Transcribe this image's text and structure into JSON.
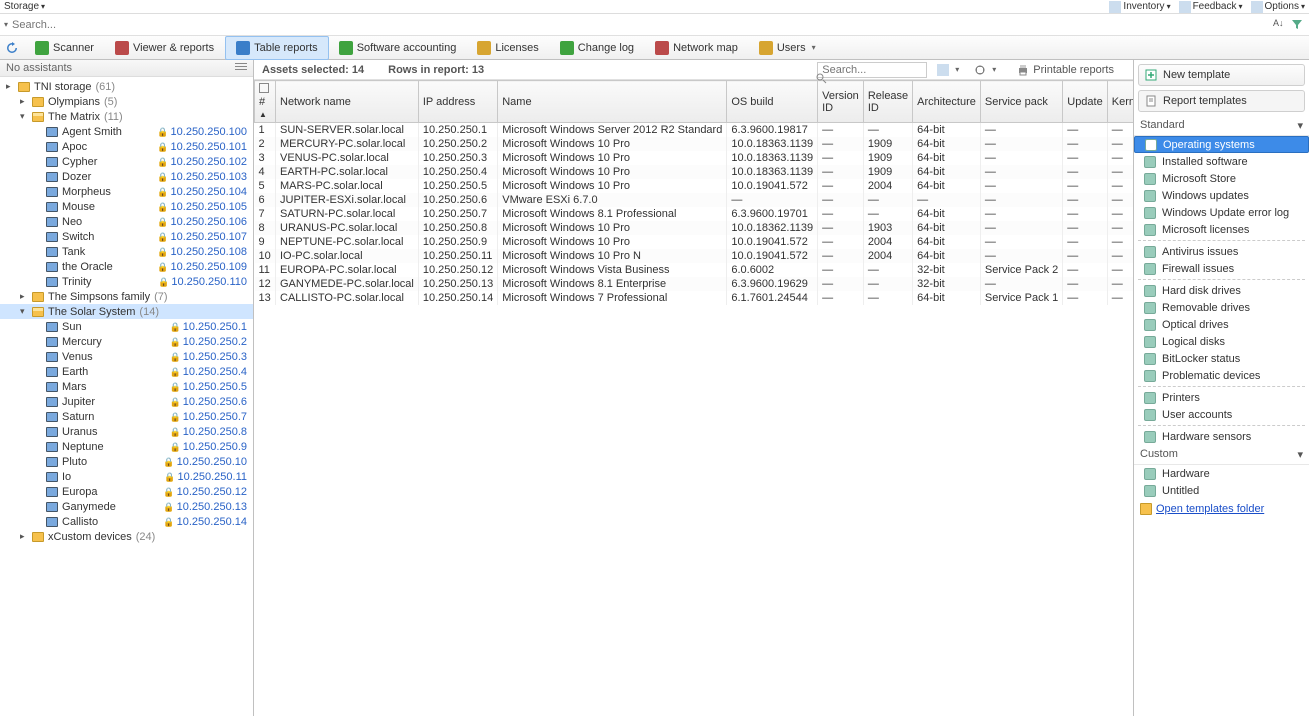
{
  "topbar": {
    "left": [
      {
        "label": "Storage",
        "dd": true
      }
    ],
    "right": [
      {
        "label": "Inventory",
        "dd": true
      },
      {
        "label": "Feedback",
        "dd": true
      },
      {
        "label": "Options",
        "dd": true
      }
    ]
  },
  "searchrow": {
    "placeholder": "Search..."
  },
  "toolbar": {
    "pre": {
      "name": "refresh"
    },
    "items": [
      {
        "name": "scanner",
        "label": "Scanner",
        "color": "#3fa33f"
      },
      {
        "name": "viewer",
        "label": "Viewer & reports",
        "color": "#bb4a4a"
      },
      {
        "name": "table",
        "label": "Table reports",
        "color": "#3a7ec9",
        "active": true
      },
      {
        "name": "software",
        "label": "Software accounting",
        "color": "#3fa33f"
      },
      {
        "name": "licenses",
        "label": "Licenses",
        "color": "#d7a531"
      },
      {
        "name": "changelog",
        "label": "Change log",
        "color": "#3fa33f"
      },
      {
        "name": "netmap",
        "label": "Network map",
        "color": "#bb4a4a"
      },
      {
        "name": "users",
        "label": "Users",
        "color": "#d7a531",
        "dd": true
      }
    ]
  },
  "sidebar": {
    "header": "No assistants",
    "tree": [
      {
        "type": "root",
        "label": "TNI storage",
        "count": "(61)"
      },
      {
        "type": "folder",
        "indent": 1,
        "label": "Olympians",
        "count": "(5)"
      },
      {
        "type": "folder",
        "indent": 1,
        "label": "The Matrix",
        "count": "(11)",
        "expanded": true
      },
      {
        "type": "pc",
        "indent": 2,
        "label": "Agent Smith",
        "ip": "10.250.250.100",
        "lock": true
      },
      {
        "type": "pc",
        "indent": 2,
        "label": "Apoc",
        "ip": "10.250.250.101",
        "lock": true
      },
      {
        "type": "pc",
        "indent": 2,
        "label": "Cypher",
        "ip": "10.250.250.102",
        "lock": true
      },
      {
        "type": "pc",
        "indent": 2,
        "label": "Dozer",
        "ip": "10.250.250.103",
        "lock": true
      },
      {
        "type": "pc",
        "indent": 2,
        "label": "Morpheus",
        "ip": "10.250.250.104",
        "lock": true
      },
      {
        "type": "pc",
        "indent": 2,
        "label": "Mouse",
        "ip": "10.250.250.105",
        "lock": true
      },
      {
        "type": "pc",
        "indent": 2,
        "label": "Neo",
        "ip": "10.250.250.106",
        "lock": true
      },
      {
        "type": "pc",
        "indent": 2,
        "label": "Switch",
        "ip": "10.250.250.107",
        "lock": true
      },
      {
        "type": "pc",
        "indent": 2,
        "label": "Tank",
        "ip": "10.250.250.108",
        "lock": true
      },
      {
        "type": "pc",
        "indent": 2,
        "label": "the Oracle",
        "ip": "10.250.250.109",
        "lock": true
      },
      {
        "type": "pc",
        "indent": 2,
        "label": "Trinity",
        "ip": "10.250.250.110",
        "lock": true
      },
      {
        "type": "folder",
        "indent": 1,
        "label": "The Simpsons family",
        "count": "(7)"
      },
      {
        "type": "folder",
        "indent": 1,
        "label": "The Solar System",
        "count": "(14)",
        "expanded": true,
        "selected": true
      },
      {
        "type": "pc",
        "indent": 2,
        "label": "Sun",
        "ip": "10.250.250.1",
        "lock": true
      },
      {
        "type": "pc",
        "indent": 2,
        "label": "Mercury",
        "ip": "10.250.250.2",
        "lock": true
      },
      {
        "type": "pc",
        "indent": 2,
        "label": "Venus",
        "ip": "10.250.250.3",
        "lock": true
      },
      {
        "type": "pc",
        "indent": 2,
        "label": "Earth",
        "ip": "10.250.250.4",
        "lock": true
      },
      {
        "type": "pc",
        "indent": 2,
        "label": "Mars",
        "ip": "10.250.250.5",
        "lock": true
      },
      {
        "type": "pc",
        "indent": 2,
        "label": "Jupiter",
        "ip": "10.250.250.6",
        "lock": true
      },
      {
        "type": "pc",
        "indent": 2,
        "label": "Saturn",
        "ip": "10.250.250.7",
        "lock": true
      },
      {
        "type": "pc",
        "indent": 2,
        "label": "Uranus",
        "ip": "10.250.250.8",
        "lock": true
      },
      {
        "type": "pc",
        "indent": 2,
        "label": "Neptune",
        "ip": "10.250.250.9",
        "lock": true
      },
      {
        "type": "pc",
        "indent": 2,
        "label": "Pluto",
        "ip": "10.250.250.10",
        "lock": true
      },
      {
        "type": "pc",
        "indent": 2,
        "label": "Io",
        "ip": "10.250.250.11",
        "lock": true
      },
      {
        "type": "pc",
        "indent": 2,
        "label": "Europa",
        "ip": "10.250.250.12",
        "lock": true
      },
      {
        "type": "pc",
        "indent": 2,
        "label": "Ganymede",
        "ip": "10.250.250.13",
        "lock": true
      },
      {
        "type": "pc",
        "indent": 2,
        "label": "Callisto",
        "ip": "10.250.250.14",
        "lock": true
      },
      {
        "type": "folder",
        "indent": 1,
        "label": "xCustom devices",
        "count": "(24)"
      }
    ]
  },
  "status": {
    "assets_label": "Assets selected:",
    "assets": "14",
    "rows_label": "Rows in report:",
    "rows": "13",
    "search_placeholder": "Search...",
    "printable": "Printable reports"
  },
  "table": {
    "columns": [
      "#",
      "Network name",
      "IP address",
      "Name",
      "OS build",
      "Version ID",
      "Release ID",
      "Architecture",
      "Service pack",
      "Update",
      "Kernel"
    ],
    "rows": [
      [
        "1",
        "SUN-SERVER.solar.local",
        "10.250.250.1",
        "Microsoft Windows Server 2012 R2 Standard",
        "6.3.9600.19817",
        "—",
        "—",
        "64-bit",
        "—",
        "—",
        "—"
      ],
      [
        "2",
        "MERCURY-PC.solar.local",
        "10.250.250.2",
        "Microsoft Windows 10 Pro",
        "10.0.18363.1139",
        "—",
        "1909",
        "64-bit",
        "—",
        "—",
        "—"
      ],
      [
        "3",
        "VENUS-PC.solar.local",
        "10.250.250.3",
        "Microsoft Windows 10 Pro",
        "10.0.18363.1139",
        "—",
        "1909",
        "64-bit",
        "—",
        "—",
        "—"
      ],
      [
        "4",
        "EARTH-PC.solar.local",
        "10.250.250.4",
        "Microsoft Windows 10 Pro",
        "10.0.18363.1139",
        "—",
        "1909",
        "64-bit",
        "—",
        "—",
        "—"
      ],
      [
        "5",
        "MARS-PC.solar.local",
        "10.250.250.5",
        "Microsoft Windows 10 Pro",
        "10.0.19041.572",
        "—",
        "2004",
        "64-bit",
        "—",
        "—",
        "—"
      ],
      [
        "6",
        "JUPITER-ESXi.solar.local",
        "10.250.250.6",
        "VMware ESXi 6.7.0",
        "—",
        "—",
        "—",
        "—",
        "—",
        "—",
        "—"
      ],
      [
        "7",
        "SATURN-PC.solar.local",
        "10.250.250.7",
        "Microsoft Windows 8.1 Professional",
        "6.3.9600.19701",
        "—",
        "—",
        "64-bit",
        "—",
        "—",
        "—"
      ],
      [
        "8",
        "URANUS-PC.solar.local",
        "10.250.250.8",
        "Microsoft Windows 10 Pro",
        "10.0.18362.1139",
        "—",
        "1903",
        "64-bit",
        "—",
        "—",
        "—"
      ],
      [
        "9",
        "NEPTUNE-PC.solar.local",
        "10.250.250.9",
        "Microsoft Windows 10 Pro",
        "10.0.19041.572",
        "—",
        "2004",
        "64-bit",
        "—",
        "—",
        "—"
      ],
      [
        "10",
        "IO-PC.solar.local",
        "10.250.250.11",
        "Microsoft Windows 10 Pro N",
        "10.0.19041.572",
        "—",
        "2004",
        "64-bit",
        "—",
        "—",
        "—"
      ],
      [
        "11",
        "EUROPA-PC.solar.local",
        "10.250.250.12",
        "Microsoft Windows Vista Business",
        "6.0.6002",
        "—",
        "—",
        "32-bit",
        "Service Pack 2",
        "—",
        "—"
      ],
      [
        "12",
        "GANYMEDE-PC.solar.local",
        "10.250.250.13",
        "Microsoft Windows 8.1 Enterprise",
        "6.3.9600.19629",
        "—",
        "—",
        "32-bit",
        "—",
        "—",
        "—"
      ],
      [
        "13",
        "CALLISTO-PC.solar.local",
        "10.250.250.14",
        "Microsoft Windows 7 Professional",
        "6.1.7601.24544",
        "—",
        "—",
        "64-bit",
        "Service Pack 1",
        "—",
        "—"
      ]
    ]
  },
  "rightpanel": {
    "new_template": "New template",
    "report_templates": "Report templates",
    "standard_label": "Standard",
    "standard": [
      {
        "label": "Operating systems",
        "selected": true
      },
      {
        "label": "Installed software"
      },
      {
        "label": "Microsoft Store"
      },
      {
        "label": "Windows updates"
      },
      {
        "label": "Windows Update error log"
      },
      {
        "label": "Microsoft licenses"
      },
      {
        "sep": true
      },
      {
        "label": "Antivirus issues"
      },
      {
        "label": "Firewall issues"
      },
      {
        "sep": true
      },
      {
        "label": "Hard disk drives"
      },
      {
        "label": "Removable drives"
      },
      {
        "label": "Optical drives"
      },
      {
        "label": "Logical disks"
      },
      {
        "label": "BitLocker status"
      },
      {
        "label": "Problematic devices"
      },
      {
        "sep": true
      },
      {
        "label": "Printers"
      },
      {
        "label": "User accounts"
      },
      {
        "sep": true
      },
      {
        "label": "Hardware sensors"
      }
    ],
    "custom_label": "Custom",
    "custom": [
      {
        "label": "Hardware"
      },
      {
        "label": "Untitled"
      }
    ],
    "open_link": "Open templates folder"
  }
}
